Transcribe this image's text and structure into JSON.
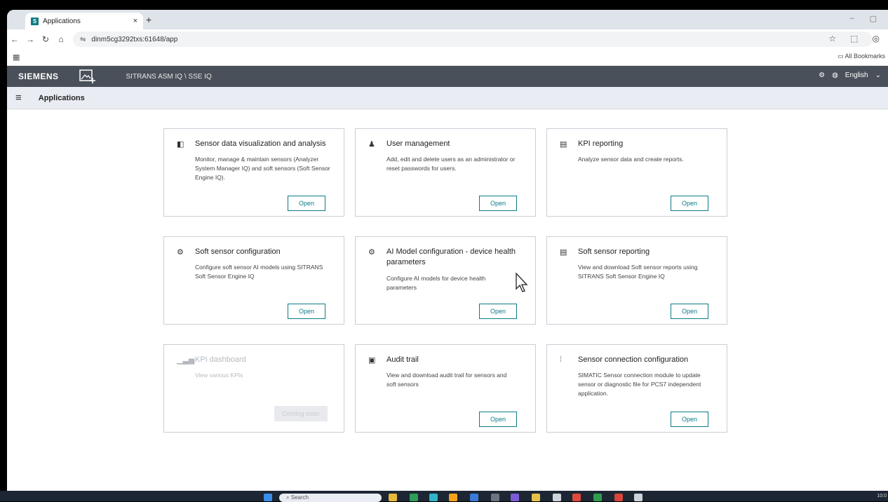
{
  "browser": {
    "tab_title": "Applications",
    "tab_favicon": "S",
    "tab_close": "×",
    "new_tab": "+",
    "url": "dinm5cg3292txs:61648/app",
    "bookmarks_label": "All Bookmarks"
  },
  "app": {
    "brand": "SIEMENS",
    "product": "SITRANS ASM IQ \\ SSE IQ",
    "language": "English",
    "page_title": "Applications"
  },
  "cards": [
    {
      "title": "Sensor data visualization and analysis",
      "desc": "Monitor, manage & maintain sensors (Analyzer System Manager IQ) and soft sensors (Soft Sensor Engine IQ).",
      "button": "Open",
      "icon": "sensor-icon"
    },
    {
      "title": "User management",
      "desc": "Add, edit and delete users as an administrator or reset passwords for users.",
      "button": "Open",
      "icon": "users-icon"
    },
    {
      "title": "KPI reporting",
      "desc": "Analyze sensor data and create reports.",
      "button": "Open",
      "icon": "report-icon"
    },
    {
      "title": "Soft sensor configuration",
      "desc": "Configure soft sensor AI models using SITRANS Soft Sensor Engine IQ",
      "button": "Open",
      "icon": "gear-icon"
    },
    {
      "title": "AI Model configuration - device health parameters",
      "desc": "Configure AI models for device health parameters",
      "button": "Open",
      "icon": "gear-icon"
    },
    {
      "title": "Soft sensor reporting",
      "desc": "View and download Soft sensor reports using SITRANS Soft Sensor Engine IQ",
      "button": "Open",
      "icon": "report-icon"
    },
    {
      "title": "KPI dashboard",
      "desc": "View various KPIs",
      "button": "Coming soon",
      "icon": "bar-chart-icon",
      "disabled": true
    },
    {
      "title": "Audit trail",
      "desc": "View and download audit trail for sensors and soft sensors",
      "button": "Open",
      "icon": "calendar-icon"
    },
    {
      "title": "Sensor connection configuration",
      "desc": "SIMATIC Sensor connection module to update sensor or diagnostic file for PCS7 independent application.",
      "button": "Open",
      "icon": "sliders-icon"
    }
  ],
  "taskbar": {
    "search_placeholder": "Search",
    "clock": "10:0"
  }
}
